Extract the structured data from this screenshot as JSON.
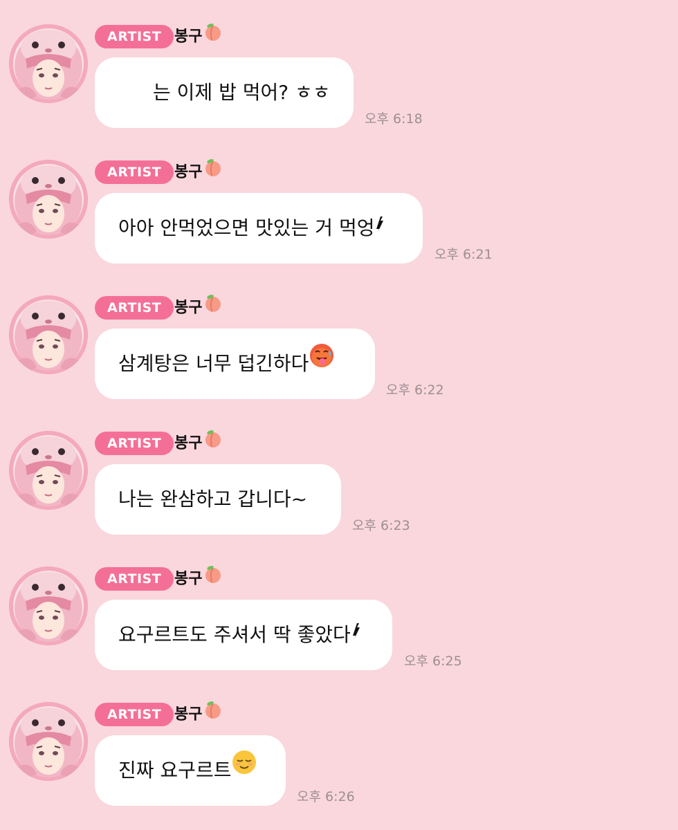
{
  "sender": {
    "badge": "ARTIST",
    "name": "봉구",
    "name_emoji": "peach"
  },
  "messages": [
    {
      "text": "는 이제 밥 먹어? ㅎㅎ",
      "emoji": "",
      "time": "오후 6:18"
    },
    {
      "text": "아아 안먹었으면 맛있는 거 먹엉",
      "emoji": "sparkle",
      "time": "오후 6:21"
    },
    {
      "text": "삼계탕은 너무 덥긴하다",
      "emoji": "hot-face",
      "time": "오후 6:22"
    },
    {
      "text": "나는 완삼하고 갑니다~",
      "emoji": "",
      "time": "오후 6:23"
    },
    {
      "text": "요구르트도 주셔서 딱 좋았다",
      "emoji": "sparkle",
      "time": "오후 6:25"
    },
    {
      "text": "진짜 요구르트",
      "emoji": "relieved-face",
      "time": "오후 6:26"
    }
  ],
  "colors": {
    "background": "#f9d7dd",
    "badge": "#f46f97",
    "bubble": "#ffffff",
    "timestamp": "#9d8e92"
  }
}
